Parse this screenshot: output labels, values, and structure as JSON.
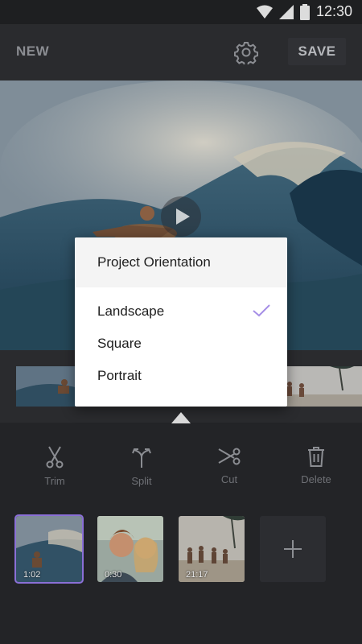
{
  "status_bar": {
    "time": "12:30",
    "icons": [
      "wifi-icon",
      "signal-icon",
      "battery-icon"
    ]
  },
  "toolbar": {
    "new_label": "NEW",
    "save_label": "SAVE",
    "settings_icon": "gear-icon"
  },
  "preview": {
    "play_icon": "play-icon"
  },
  "dialog": {
    "title": "Project Orientation",
    "options": [
      {
        "label": "Landscape",
        "selected": true
      },
      {
        "label": "Square",
        "selected": false
      },
      {
        "label": "Portrait",
        "selected": false
      }
    ],
    "check_icon": "check-icon"
  },
  "tools": [
    {
      "label": "Trim",
      "icon": "scissors-icon"
    },
    {
      "label": "Split",
      "icon": "split-icon"
    },
    {
      "label": "Cut",
      "icon": "cut-icon"
    },
    {
      "label": "Delete",
      "icon": "trash-icon"
    }
  ],
  "clips": [
    {
      "duration": "1:02",
      "selected": true
    },
    {
      "duration": "0:30",
      "selected": false
    },
    {
      "duration": "21:17",
      "selected": false
    }
  ],
  "add_clip": {
    "icon": "plus-icon"
  },
  "colors": {
    "accent": "#8a6fd6",
    "background": "#232427",
    "toolbar": "#2a2b2e"
  }
}
